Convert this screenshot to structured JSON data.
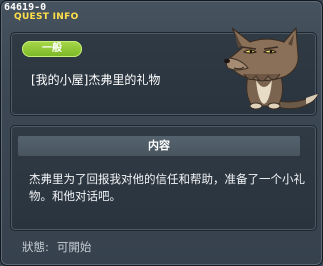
{
  "window": {
    "quest_id": "64619-0",
    "title": "QUEST INFO"
  },
  "quest": {
    "category": "一般",
    "name": "[我的小屋]杰弗里的礼物",
    "section_title": "内容",
    "description": "杰弗里为了回报我对他的信任和帮助，准备了一个小礼物。和他对话吧。",
    "status_label": "狀態:",
    "status_value": "可開始"
  },
  "colors": {
    "title": "#ffe04a",
    "badge": "#8cc63a",
    "panel": "#2c3641"
  },
  "icons": {
    "npc": "wolf-npc-portrait"
  }
}
